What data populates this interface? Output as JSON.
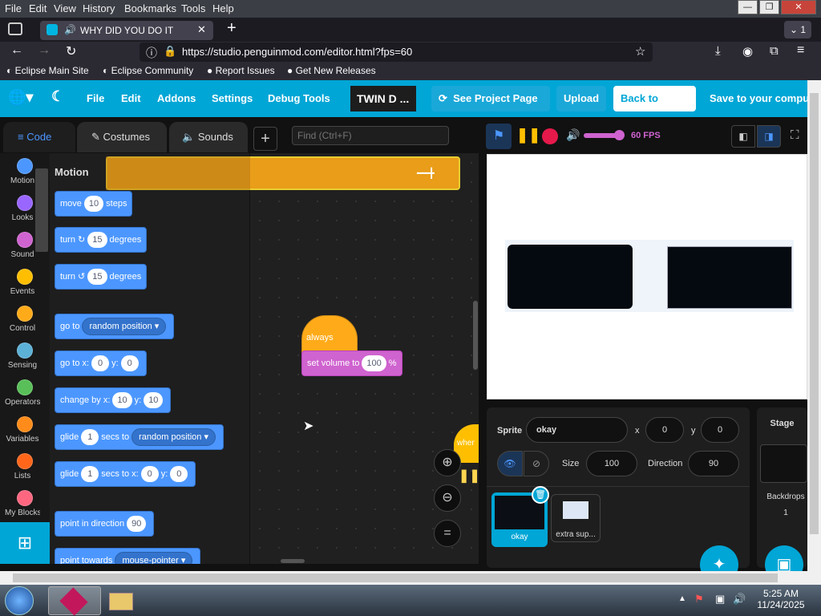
{
  "browser": {
    "menu": [
      "File",
      "Edit",
      "View",
      "History",
      "Bookmarks",
      "Tools",
      "Help"
    ],
    "tab_title": "WHY DID YOU DO IT",
    "tab_count": "1",
    "url": "https://studio.penguinmod.com/editor.html?fps=60",
    "bookmarks": [
      "Eclipse Main Site",
      "Eclipse Community",
      "Report Issues",
      "Get New Releases"
    ]
  },
  "app_header": {
    "menus": [
      "File",
      "Edit",
      "Addons",
      "Settings",
      "Debug Tools"
    ],
    "project_title": "TWIN D ...",
    "see_project": "See Project Page",
    "upload": "Upload",
    "back_home": "Back to Home",
    "save": "Save to your compute"
  },
  "editor_tabs": {
    "code": "Code",
    "costumes": "Costumes",
    "sounds": "Sounds",
    "add": "+"
  },
  "search": {
    "placeholder": "Find (Ctrl+F)"
  },
  "categories": [
    {
      "label": "Motion",
      "color": "#4c97ff"
    },
    {
      "label": "Looks",
      "color": "#9966ff"
    },
    {
      "label": "Sound",
      "color": "#cf63cf"
    },
    {
      "label": "Events",
      "color": "#ffbf00"
    },
    {
      "label": "Control",
      "color": "#ffab19"
    },
    {
      "label": "Sensing",
      "color": "#5cb1d6"
    },
    {
      "label": "Operators",
      "color": "#59c059"
    },
    {
      "label": "Variables",
      "color": "#ff8c1a"
    },
    {
      "label": "Lists",
      "color": "#ff661a"
    },
    {
      "label": "My Blocks",
      "color": "#ff6680"
    }
  ],
  "palette": {
    "heading": "Motion",
    "move": {
      "pre": "move",
      "val": "10",
      "post": "steps"
    },
    "turn_right": {
      "pre": "turn",
      "val": "15",
      "post": "degrees"
    },
    "turn_left": {
      "pre": "turn",
      "val": "15",
      "post": "degrees"
    },
    "goto": {
      "pre": "go to",
      "drop": "random position"
    },
    "gotoxy": {
      "pre": "go to x:",
      "x": "0",
      "ylbl": "y:",
      "y": "0"
    },
    "changeby": {
      "pre": "change by x:",
      "x": "10",
      "ylbl": "y:",
      "y": "10"
    },
    "glide_rand": {
      "pre": "glide",
      "val": "1",
      "mid": "secs to",
      "drop": "random position"
    },
    "glide_xy": {
      "pre": "glide",
      "val": "1",
      "mid": "secs to x:",
      "x": "0",
      "ylbl": "y:",
      "y": "0"
    },
    "point_dir": {
      "pre": "point in direction",
      "val": "90"
    },
    "point_towards": {
      "pre": "point towards",
      "drop": "mouse-pointer"
    }
  },
  "workspace": {
    "always_hat": "always",
    "set_volume": {
      "pre": "set volume to",
      "val": "100",
      "post": "%"
    },
    "when_partial": "wher"
  },
  "stage_controls": {
    "fps": "60 FPS"
  },
  "sprite_info": {
    "sprite_label": "Sprite",
    "sprite_name": "okay",
    "x_label": "x",
    "x": "0",
    "y_label": "y",
    "y": "0",
    "size_label": "Size",
    "size": "100",
    "direction_label": "Direction",
    "direction": "90"
  },
  "sprites": [
    {
      "name": "okay",
      "selected": true
    },
    {
      "name": "extra sup...",
      "selected": false
    }
  ],
  "stage_panel": {
    "title": "Stage",
    "backdrops_label": "Backdrops",
    "backdrops": "1"
  },
  "taskbar": {
    "time": "5:25 AM",
    "date": "11/24/2025"
  },
  "colors": {
    "accent": "#00a6d6",
    "motion": "#4c97ff",
    "control": "#ffab19",
    "events": "#ffbf00",
    "sound": "#cf63cf"
  }
}
